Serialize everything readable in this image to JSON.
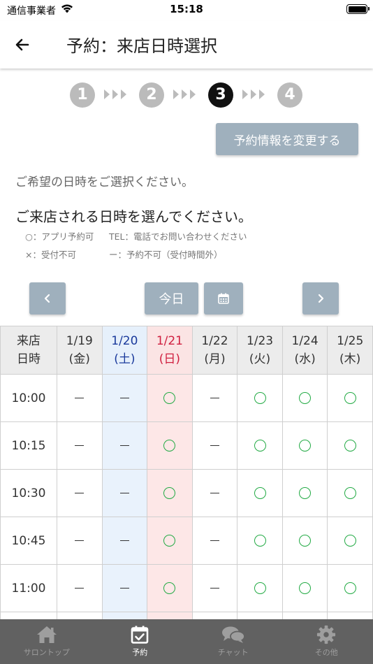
{
  "status_bar": {
    "carrier": "通信事業者",
    "time": "15:18"
  },
  "nav": {
    "title": "予約：来店日時選択"
  },
  "stepper": {
    "steps": [
      "1",
      "2",
      "3",
      "4"
    ],
    "active_index": 2
  },
  "change_button": "予約情報を変更する",
  "hint": "ご希望の日時をご選択ください。",
  "subheading": "ご来店される日時を選んでください。",
  "legend": {
    "app": "○：アプリ予約可",
    "tel": "TEL：電話でお問い合わせください",
    "x": "×：受付不可",
    "dash": "ー：予約不可（受付時間外）"
  },
  "cal_nav": {
    "prev": "‹",
    "today": "今日",
    "calendar_icon": "calendar-icon",
    "next": "›"
  },
  "table": {
    "corner": [
      "来店",
      "日時"
    ],
    "columns": [
      {
        "date": "1/19",
        "day": "(金)",
        "type": "weekday"
      },
      {
        "date": "1/20",
        "day": "(土)",
        "type": "sat"
      },
      {
        "date": "1/21",
        "day": "(日)",
        "type": "sun"
      },
      {
        "date": "1/22",
        "day": "(月)",
        "type": "weekday"
      },
      {
        "date": "1/23",
        "day": "(火)",
        "type": "weekday"
      },
      {
        "date": "1/24",
        "day": "(水)",
        "type": "weekday"
      },
      {
        "date": "1/25",
        "day": "(木)",
        "type": "weekday"
      }
    ],
    "rows": [
      {
        "time": "10:00",
        "slots": [
          "dash",
          "dash",
          "circle",
          "dash",
          "circle",
          "circle",
          "circle"
        ]
      },
      {
        "time": "10:15",
        "slots": [
          "dash",
          "dash",
          "circle",
          "dash",
          "circle",
          "circle",
          "circle"
        ]
      },
      {
        "time": "10:30",
        "slots": [
          "dash",
          "dash",
          "circle",
          "dash",
          "circle",
          "circle",
          "circle"
        ]
      },
      {
        "time": "10:45",
        "slots": [
          "dash",
          "dash",
          "circle",
          "dash",
          "circle",
          "circle",
          "circle"
        ]
      },
      {
        "time": "11:00",
        "slots": [
          "dash",
          "dash",
          "circle",
          "dash",
          "circle",
          "circle",
          "circle"
        ]
      },
      {
        "time": "",
        "slots": [
          "",
          "",
          "",
          "",
          "",
          "",
          ""
        ]
      }
    ]
  },
  "tabs": [
    {
      "label": "サロントップ",
      "icon": "home-icon",
      "active": false
    },
    {
      "label": "予約",
      "icon": "calendar-check-icon",
      "active": true
    },
    {
      "label": "チャット",
      "icon": "chat-icon",
      "active": false
    },
    {
      "label": "その他",
      "icon": "gear-icon",
      "active": false
    }
  ],
  "colors": {
    "button": "#9fb0bd",
    "sat_bg": "#e9f2fc",
    "sun_bg": "#fde7e7",
    "sat_text": "#1a3a9c",
    "sun_text": "#d02040",
    "available": "#22aa44",
    "tab_bar": "#616161"
  }
}
